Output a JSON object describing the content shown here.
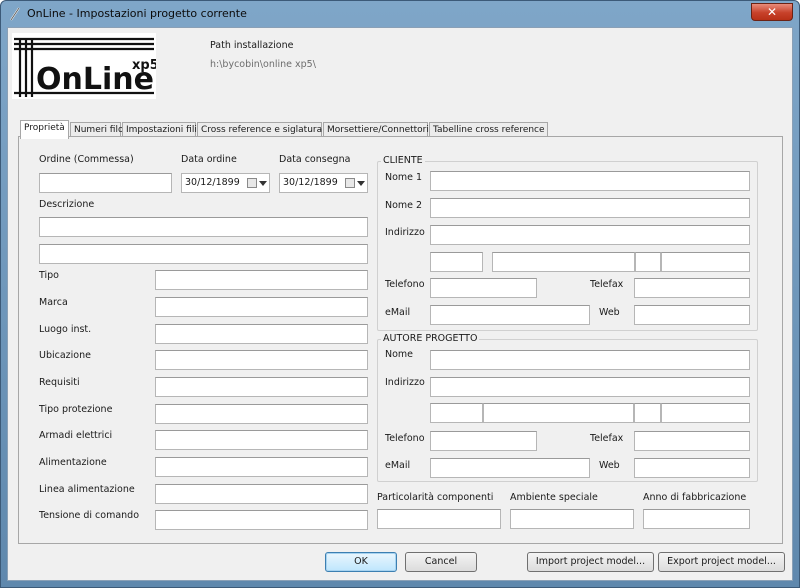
{
  "window": {
    "title": "OnLine - Impostazioni progetto corrente",
    "close_label": "✕"
  },
  "header": {
    "logo_text": "OnLine",
    "logo_suffix": "xp5",
    "path_label": "Path installazione",
    "path_value": "h:\\bycobin\\online xp5\\"
  },
  "tabs": [
    {
      "label": "Proprietà"
    },
    {
      "label": "Numeri filo"
    },
    {
      "label": "Impostazioni fili"
    },
    {
      "label": "Cross reference e siglatura"
    },
    {
      "label": "Morsettiere/Connettori"
    },
    {
      "label": "Tabelline cross reference"
    }
  ],
  "props": {
    "ordine_label": "Ordine (Commessa)",
    "ordine_value": "",
    "data_ordine_label": "Data ordine",
    "data_ordine_value": "30/12/1899",
    "data_consegna_label": "Data consegna",
    "data_consegna_value": "30/12/1899",
    "descrizione_label": "Descrizione",
    "fields": [
      {
        "label": "Tipo"
      },
      {
        "label": "Marca"
      },
      {
        "label": "Luogo inst."
      },
      {
        "label": "Ubicazione"
      },
      {
        "label": "Requisiti"
      },
      {
        "label": "Tipo protezione"
      },
      {
        "label": "Armadi elettrici"
      },
      {
        "label": "Alimentazione"
      },
      {
        "label": "Linea alimentazione"
      },
      {
        "label": "Tensione di comando"
      }
    ]
  },
  "cliente": {
    "title": "CLIENTE",
    "nome1": "Nome 1",
    "nome2": "Nome 2",
    "indirizzo": "Indirizzo",
    "telefono": "Telefono",
    "telefax": "Telefax",
    "email": "eMail",
    "web": "Web"
  },
  "autore": {
    "title": "AUTORE PROGETTO",
    "nome": "Nome",
    "indirizzo": "Indirizzo",
    "telefono": "Telefono",
    "telefax": "Telefax",
    "email": "eMail",
    "web": "Web"
  },
  "extra": {
    "particolarita": "Particolarità componenti",
    "ambiente": "Ambiente speciale",
    "anno": "Anno di fabbricazione"
  },
  "buttons": {
    "ok": "OK",
    "cancel": "Cancel",
    "import": "Import project model...",
    "export": "Export project model..."
  }
}
